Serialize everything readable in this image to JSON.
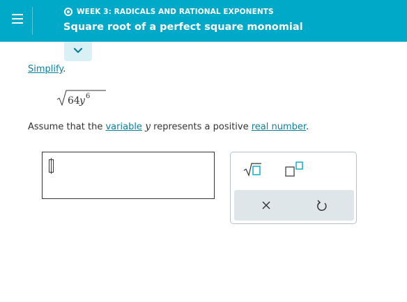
{
  "header": {
    "week_label": "WEEK 3: RADICALS AND RATIONAL EXPONENTS",
    "topic_title": "Square root of a perfect square monomial",
    "background_color": "#00a9c7"
  },
  "problem": {
    "instruction_link": "Simplify",
    "instruction_period": ".",
    "expression": {
      "radicand_coefficient": "64",
      "variable": "y",
      "exponent": "6"
    },
    "assumption": {
      "prefix": "Assume that the ",
      "variable_link": "variable",
      "variable_symbol": "y",
      "middle": " represents a positive ",
      "number_link": "real number",
      "suffix": "."
    }
  },
  "answer": {
    "value": ""
  },
  "toolbar": {
    "icons": [
      "square-root-icon",
      "exponent-icon",
      "clear-icon",
      "undo-icon"
    ]
  },
  "colors": {
    "accent": "#00a9c7",
    "link": "#0b7f9e",
    "toolbar_bg": "#dfe6ea",
    "tab_toggle": "#d9f0f4"
  }
}
